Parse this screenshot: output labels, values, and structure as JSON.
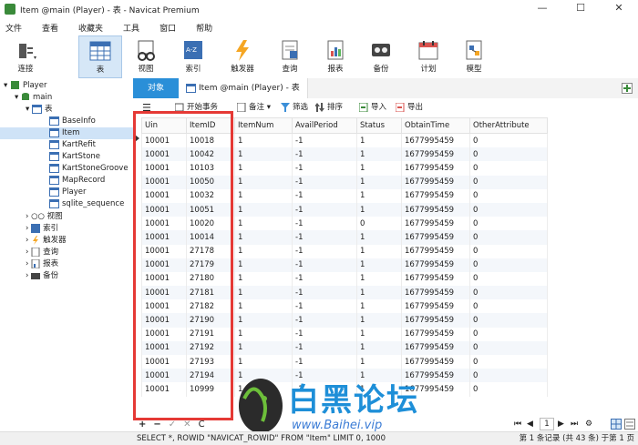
{
  "window": {
    "title": "Item @main (Player) - 表 - Navicat Premium",
    "min": "—",
    "max": "☐",
    "close": "✕"
  },
  "menu": [
    "文件",
    "查看",
    "收藏夹",
    "工具",
    "窗口",
    "帮助"
  ],
  "toolbar": [
    {
      "label": "连接",
      "icon": "plug-icon"
    },
    {
      "label": "表",
      "icon": "table-icon",
      "active": true
    },
    {
      "label": "视图",
      "icon": "view-icon"
    },
    {
      "label": "索引",
      "icon": "index-icon"
    },
    {
      "label": "触发器",
      "icon": "trigger-icon"
    },
    {
      "label": "查询",
      "icon": "query-icon"
    },
    {
      "label": "报表",
      "icon": "report-icon"
    },
    {
      "label": "备份",
      "icon": "backup-icon"
    },
    {
      "label": "计划",
      "icon": "schedule-icon"
    },
    {
      "label": "模型",
      "icon": "model-icon"
    }
  ],
  "tree": {
    "connection": "Player",
    "database": "main",
    "tables_group": "表",
    "tables": [
      "BaseInfo",
      "Item",
      "KartRefit",
      "KartStone",
      "KartStoneGroove",
      "MapRecord",
      "Player",
      "sqlite_sequence"
    ],
    "selected_table": "Item",
    "groups": [
      "视图",
      "索引",
      "触发器",
      "查询",
      "报表",
      "备份"
    ]
  },
  "tabs": {
    "objects": "对象",
    "item": "Item @main (Player) - 表"
  },
  "subtoolbar": {
    "menu": "☰",
    "begin_tx": "开始事务",
    "memo": "备注",
    "filter": "筛选",
    "sort": "排序",
    "import": "导入",
    "export": "导出"
  },
  "table": {
    "columns": [
      "Uin",
      "ItemID",
      "ItemNum",
      "AvailPeriod",
      "Status",
      "ObtainTime",
      "OtherAttribute"
    ],
    "rows": [
      [
        "10001",
        "10018",
        "1",
        "-1",
        "1",
        "1677995459",
        "0"
      ],
      [
        "10001",
        "10042",
        "1",
        "-1",
        "1",
        "1677995459",
        "0"
      ],
      [
        "10001",
        "10103",
        "1",
        "-1",
        "1",
        "1677995459",
        "0"
      ],
      [
        "10001",
        "10050",
        "1",
        "-1",
        "1",
        "1677995459",
        "0"
      ],
      [
        "10001",
        "10032",
        "1",
        "-1",
        "1",
        "1677995459",
        "0"
      ],
      [
        "10001",
        "10051",
        "1",
        "-1",
        "1",
        "1677995459",
        "0"
      ],
      [
        "10001",
        "10020",
        "1",
        "-1",
        "0",
        "1677995459",
        "0"
      ],
      [
        "10001",
        "10014",
        "1",
        "-1",
        "1",
        "1677995459",
        "0"
      ],
      [
        "10001",
        "27178",
        "1",
        "-1",
        "1",
        "1677995459",
        "0"
      ],
      [
        "10001",
        "27179",
        "1",
        "-1",
        "1",
        "1677995459",
        "0"
      ],
      [
        "10001",
        "27180",
        "1",
        "-1",
        "1",
        "1677995459",
        "0"
      ],
      [
        "10001",
        "27181",
        "1",
        "-1",
        "1",
        "1677995459",
        "0"
      ],
      [
        "10001",
        "27182",
        "1",
        "-1",
        "1",
        "1677995459",
        "0"
      ],
      [
        "10001",
        "27190",
        "1",
        "-1",
        "1",
        "1677995459",
        "0"
      ],
      [
        "10001",
        "27191",
        "1",
        "-1",
        "1",
        "1677995459",
        "0"
      ],
      [
        "10001",
        "27192",
        "1",
        "-1",
        "1",
        "1677995459",
        "0"
      ],
      [
        "10001",
        "27193",
        "1",
        "-1",
        "1",
        "1677995459",
        "0"
      ],
      [
        "10001",
        "27194",
        "1",
        "-1",
        "1",
        "1677995459",
        "0"
      ],
      [
        "10001",
        "10999",
        "1",
        "-1",
        "1",
        "1677995459",
        "0"
      ]
    ]
  },
  "bottom": {
    "add": "+",
    "remove": "−",
    "apply": "✓",
    "discard": "✕",
    "refresh": "C",
    "page": "1"
  },
  "status": {
    "sql": "SELECT *, ROWID \"NAVICAT_ROWID\" FROM \"Item\" LIMIT 0, 1000",
    "records": "第 1 条记录 (共 43 条) 于第 1 页"
  },
  "watermark": {
    "text": "白黑论坛",
    "url": "www.Baihei.vip"
  },
  "colors": {
    "accent": "#2a8fd8",
    "highlight_box": "#e53935",
    "selection": "#cfe3f7"
  }
}
